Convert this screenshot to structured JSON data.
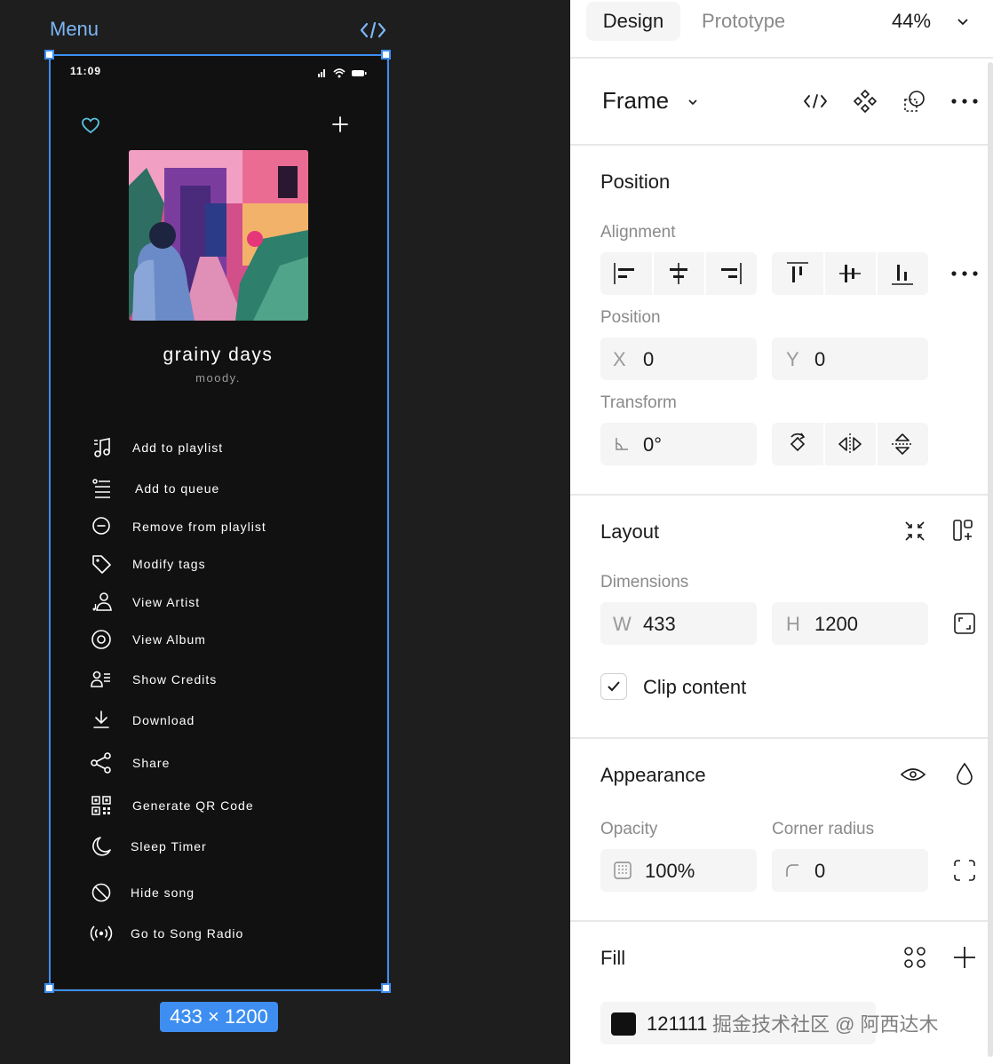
{
  "canvas": {
    "frame_label": "Menu",
    "size_badge": "433 × 1200",
    "accent": "#3d8ef0"
  },
  "phone": {
    "time": "11:09",
    "song": {
      "title": "grainy days",
      "subtitle": "moody."
    },
    "menu_items": [
      {
        "label": "Add to playlist",
        "icon": "music-playlist-icon"
      },
      {
        "label": "Add to queue",
        "icon": "queue-list-icon"
      },
      {
        "label": "Remove from playlist",
        "icon": "minus-circle-icon"
      },
      {
        "label": "Modify tags",
        "icon": "tag-icon"
      },
      {
        "label": "View Artist",
        "icon": "artist-icon"
      },
      {
        "label": "View Album",
        "icon": "album-disc-icon"
      },
      {
        "label": "Show Credits",
        "icon": "credits-icon"
      },
      {
        "label": "Download",
        "icon": "download-icon"
      },
      {
        "label": "Share",
        "icon": "share-icon"
      },
      {
        "label": "Generate QR Code",
        "icon": "qr-code-icon"
      },
      {
        "label": "Sleep Timer",
        "icon": "moon-icon"
      },
      {
        "label": "Hide song",
        "icon": "block-icon"
      },
      {
        "label": "Go to Song Radio",
        "icon": "radio-icon"
      }
    ],
    "background": "#121111"
  },
  "panel": {
    "tabs": {
      "design": "Design",
      "prototype": "Prototype"
    },
    "zoom": "44%",
    "frame_title": "Frame",
    "position": {
      "title": "Position",
      "alignment_label": "Alignment",
      "position_label": "Position",
      "x_prefix": "X",
      "x_value": "0",
      "y_prefix": "Y",
      "y_value": "0",
      "transform_label": "Transform",
      "rotation_value": "0°"
    },
    "layout": {
      "title": "Layout",
      "dimensions_label": "Dimensions",
      "w_prefix": "W",
      "w_value": "433",
      "h_prefix": "H",
      "h_value": "1200",
      "clip_content_label": "Clip content",
      "clip_content_checked": true
    },
    "appearance": {
      "title": "Appearance",
      "opacity_label": "Opacity",
      "opacity_value": "100%",
      "corner_radius_label": "Corner radius",
      "corner_radius_value": "0"
    },
    "fill": {
      "title": "Fill",
      "hex": "121111",
      "swatch_color": "#121111"
    },
    "watermark": "掘金技术社区 @ 阿西达木"
  }
}
